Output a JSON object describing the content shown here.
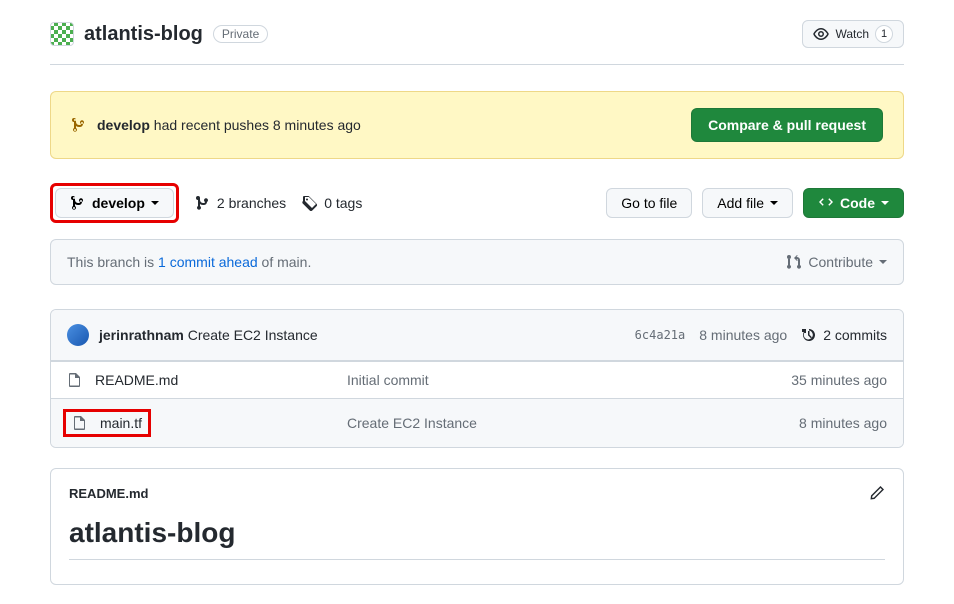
{
  "header": {
    "repo_name": "atlantis-blog",
    "visibility": "Private",
    "watch_label": "Watch",
    "watch_count": "1"
  },
  "banner": {
    "branch": "develop",
    "message": " had recent pushes 8 minutes ago",
    "cta": "Compare & pull request"
  },
  "toolbar": {
    "branch_name": "develop",
    "branches": "2 branches",
    "tags": "0 tags",
    "go_to_file": "Go to file",
    "add_file": "Add file",
    "code": "Code"
  },
  "compare": {
    "prefix": "This branch is ",
    "link": "1 commit ahead",
    "suffix": " of main.",
    "contribute": "Contribute"
  },
  "latest_commit": {
    "author": "jerinrathnam",
    "message": "Create EC2 Instance",
    "sha": "6c4a21a",
    "time": "8 minutes ago",
    "commits_count": "2 commits"
  },
  "files": [
    {
      "name": "README.md",
      "message": "Initial commit",
      "time": "35 minutes ago",
      "highlighted": false
    },
    {
      "name": "main.tf",
      "message": "Create EC2 Instance",
      "time": "8 minutes ago",
      "highlighted": true
    }
  ],
  "readme": {
    "filename": "README.md",
    "heading": "atlantis-blog"
  }
}
